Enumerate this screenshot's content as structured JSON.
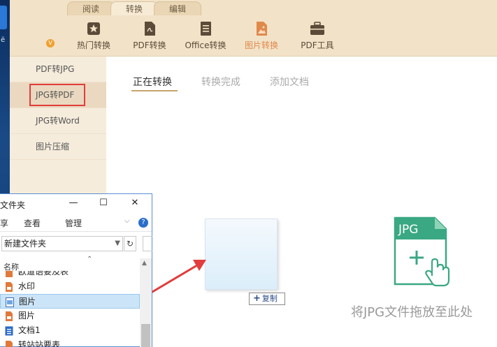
{
  "toolbar": {
    "tabs": [
      {
        "label": "阅读"
      },
      {
        "label": "转换"
      },
      {
        "label": "编辑"
      }
    ],
    "tools": [
      {
        "label": "热门转换",
        "icon": "star-icon"
      },
      {
        "label": "PDF转换",
        "icon": "pdf-icon"
      },
      {
        "label": "Office转换",
        "icon": "document-icon"
      },
      {
        "label": "图片转换",
        "icon": "image-icon"
      },
      {
        "label": "PDF工具",
        "icon": "toolbox-icon"
      }
    ],
    "badge": "V",
    "accent": "#e0894a",
    "background": "#f2e2c8"
  },
  "sidebar": {
    "items": [
      {
        "label": "PDF转JPG"
      },
      {
        "label": "JPG转PDF"
      },
      {
        "label": "JPG转Word"
      },
      {
        "label": "图片压缩"
      }
    ],
    "highlight_color": "#e23c3c"
  },
  "main": {
    "tabs": [
      {
        "label": "正在转换"
      },
      {
        "label": "转换完成"
      },
      {
        "label": "添加文档"
      }
    ],
    "copy_tip": "复制",
    "jpg_label": "JPG",
    "drop_hint": "将JPG文件拖放至此处",
    "icon_color": "#3aa882"
  },
  "explorer": {
    "title": "文件夹",
    "ribbon": [
      "享",
      "查看",
      "管理"
    ],
    "address": "新建文件夹",
    "column_header": "名称",
    "files": [
      {
        "name": "欧道语要及表",
        "type": "pdf"
      },
      {
        "name": "水印",
        "type": "pdf"
      },
      {
        "name": "图片",
        "type": "image",
        "selected": true
      },
      {
        "name": "图片",
        "type": "pdf"
      },
      {
        "name": "文档1",
        "type": "doc"
      },
      {
        "name": "转站站要表",
        "type": "pdf"
      }
    ]
  },
  "desktop": {
    "label": "ё"
  }
}
